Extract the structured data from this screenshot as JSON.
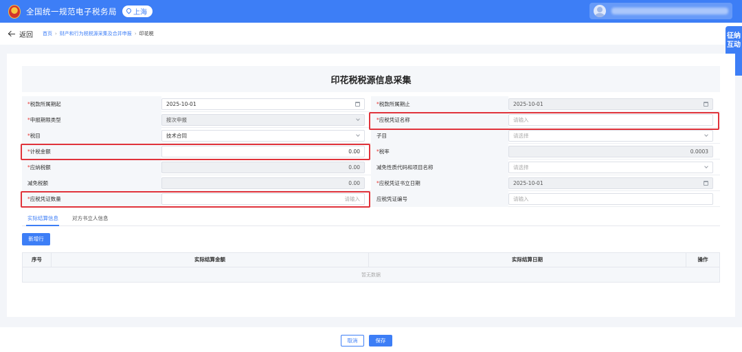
{
  "header": {
    "app_title": "全国统一规范电子税务局",
    "region": "上海"
  },
  "breadcrumb": {
    "back": "返回",
    "items": [
      "首页",
      "财产和行为税税源采集及合并申报",
      "印花税"
    ],
    "separator": "›"
  },
  "side_float": {
    "label": "征纳互动"
  },
  "form": {
    "title": "印花税税源信息采集",
    "rows": [
      {
        "left_label": "税款所属期起",
        "left_required": true,
        "left_value": "2025-10-01",
        "right_label": "税款所属期止",
        "right_required": true,
        "right_value": "2025-10-01"
      },
      {
        "left_label": "申报期限类型",
        "left_required": true,
        "left_value": "按次申报",
        "right_label": "应税凭证名称",
        "right_required": true,
        "right_placeholder": "请输入"
      },
      {
        "left_label": "税目",
        "left_required": true,
        "left_value": "技术合同",
        "right_label": "子目",
        "right_required": false,
        "right_placeholder": "请选择"
      },
      {
        "left_label": "计税金额",
        "left_required": true,
        "left_value": "0.00",
        "right_label": "税率",
        "right_required": true,
        "right_value": "0.0003"
      },
      {
        "left_label": "应纳税额",
        "left_required": true,
        "left_value": "0.00",
        "right_label": "减免性质代码和项目名称",
        "right_required": false,
        "right_placeholder": "请选择"
      },
      {
        "left_label": "减免税额",
        "left_required": false,
        "left_value": "0.00",
        "right_label": "应税凭证书立日期",
        "right_required": true,
        "right_value": "2025-10-01"
      },
      {
        "left_label": "应税凭证数量",
        "left_required": true,
        "left_placeholder": "请输入",
        "right_label": "应税凭证编号",
        "right_required": false,
        "right_placeholder": "请输入"
      }
    ]
  },
  "tabs": [
    {
      "label": "实际结算信息",
      "active": true
    },
    {
      "label": "对方书立人信息",
      "active": false
    }
  ],
  "add_row_label": "新增行",
  "table": {
    "columns": [
      "序号",
      "实际结算金额",
      "实际结算日期",
      "操作"
    ],
    "empty_text": "暂无数据"
  },
  "footer": {
    "cancel_label": "取消",
    "save_label": "保存"
  },
  "colors": {
    "primary": "#3d7ef6",
    "highlight": "#e0323a",
    "required": "#e53935"
  }
}
